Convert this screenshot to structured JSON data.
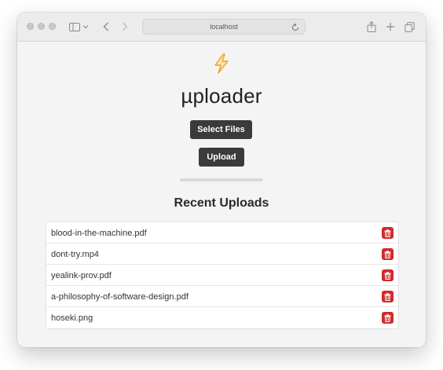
{
  "browser": {
    "address": "localhost"
  },
  "app": {
    "title": "µploader",
    "icon": "lightning-bolt-icon",
    "accent_color": "#f5a623"
  },
  "actions": {
    "select_files_label": "Select Files",
    "upload_label": "Upload"
  },
  "progress": {
    "value": 0
  },
  "recent": {
    "title": "Recent Uploads",
    "delete_color": "#d12a2a",
    "items": [
      {
        "name": "blood-in-the-machine.pdf"
      },
      {
        "name": "dont-try.mp4"
      },
      {
        "name": "yealink-prov.pdf"
      },
      {
        "name": "a-philosophy-of-software-design.pdf"
      },
      {
        "name": "hoseki.png"
      }
    ]
  }
}
